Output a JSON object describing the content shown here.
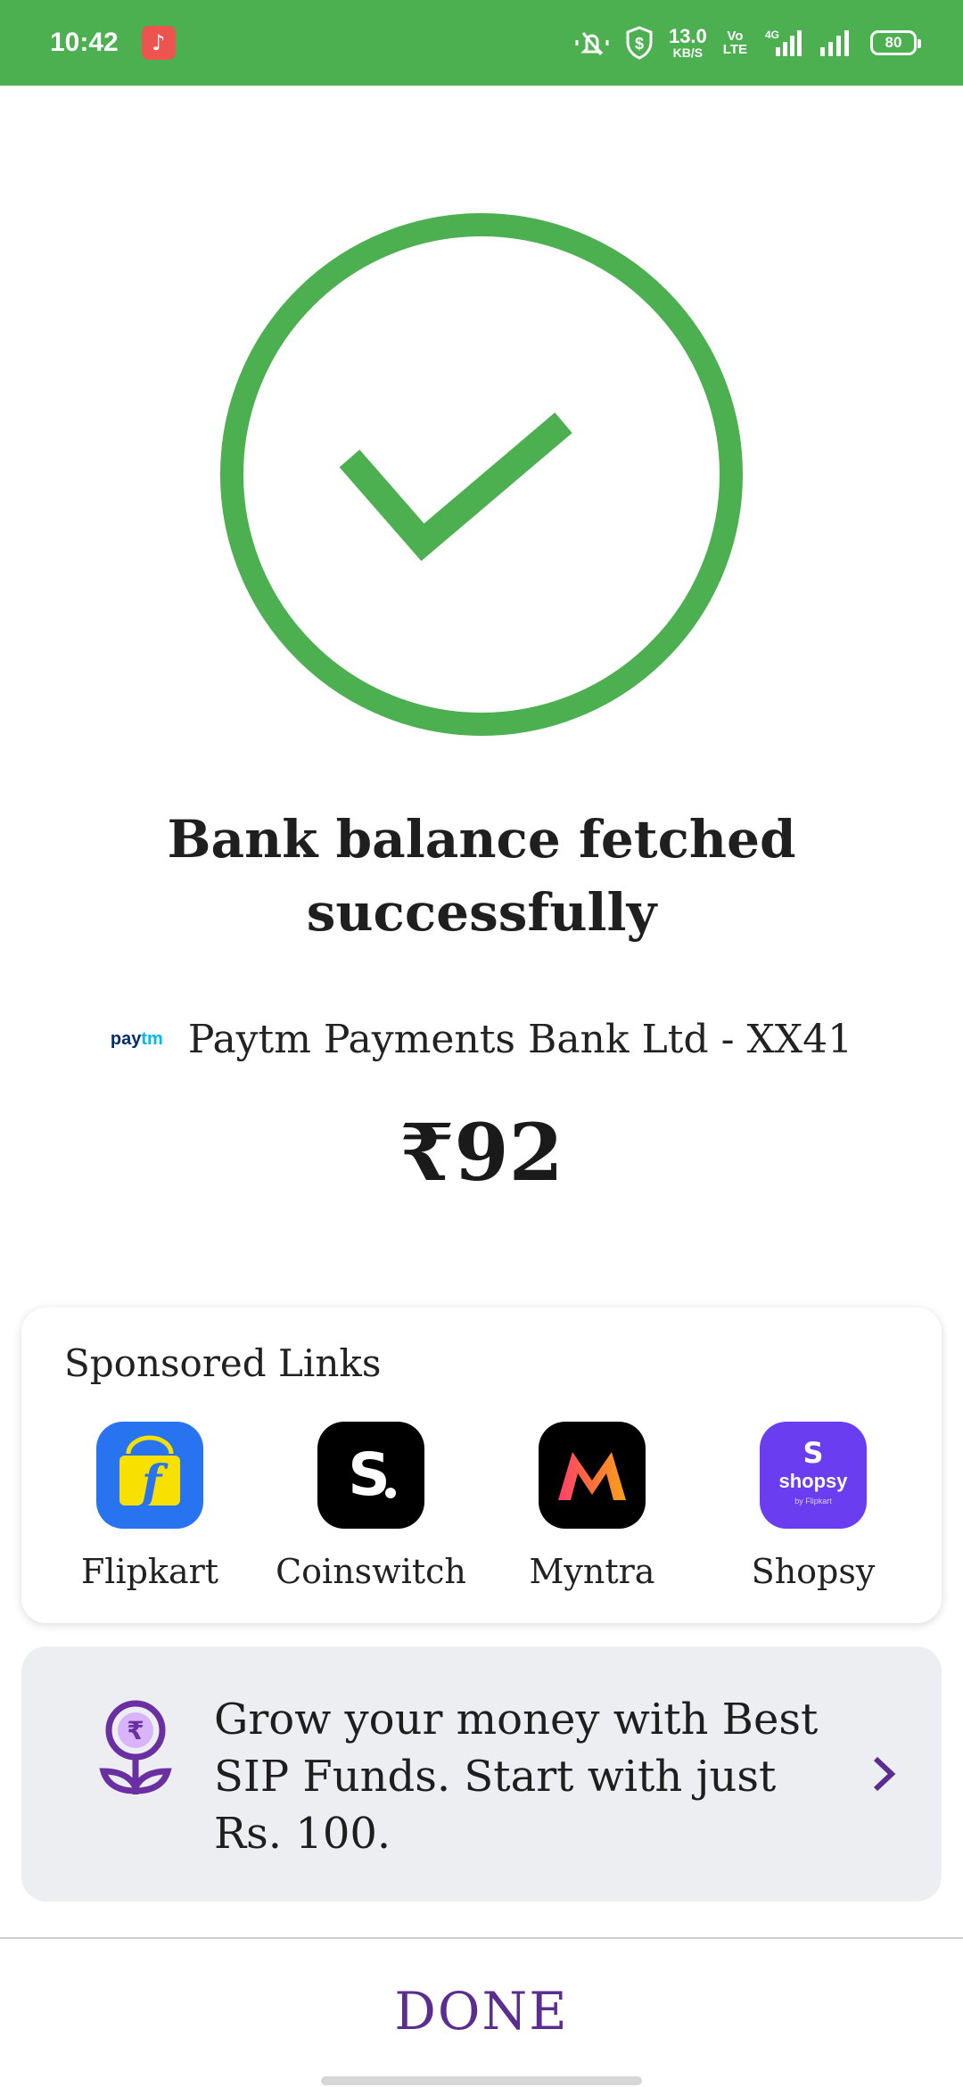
{
  "status_bar": {
    "time": "10:42",
    "net_speed_value": "13.0",
    "net_speed_unit": "KB/S",
    "volte_top": "Vo",
    "volte_bottom": "LTE",
    "network_type": "4G",
    "battery": "80",
    "icons": [
      "music-notification-icon",
      "mute-icon",
      "vpn-shield-icon",
      "signal-icon",
      "signal-icon",
      "battery-icon"
    ]
  },
  "colors": {
    "status_bar": "#4caf50",
    "success_green": "#4caf50",
    "accent_purple": "#5b2d8e"
  },
  "result": {
    "title": "Bank balance fetched successfully",
    "bank_logo_text_pay": "pay",
    "bank_logo_text_tm": "tm",
    "bank_account": "Paytm Payments Bank Ltd - XX41",
    "balance": "₹92"
  },
  "sponsored": {
    "title": "Sponsored Links",
    "apps": [
      {
        "label": "Flipkart",
        "icon": "flipkart-icon"
      },
      {
        "label": "Coinswitch",
        "icon": "coinswitch-icon"
      },
      {
        "label": "Myntra",
        "icon": "myntra-icon"
      },
      {
        "label": "Shopsy",
        "icon": "shopsy-icon"
      }
    ],
    "shopsy_icon_text": "shopsy",
    "shopsy_icon_sub": "by Flipkart"
  },
  "sip_banner": {
    "text": "Grow your money with Best SIP Funds. Start with just Rs. 100.",
    "icon": "rupee-plant-icon"
  },
  "footer": {
    "done_label": "DONE"
  }
}
